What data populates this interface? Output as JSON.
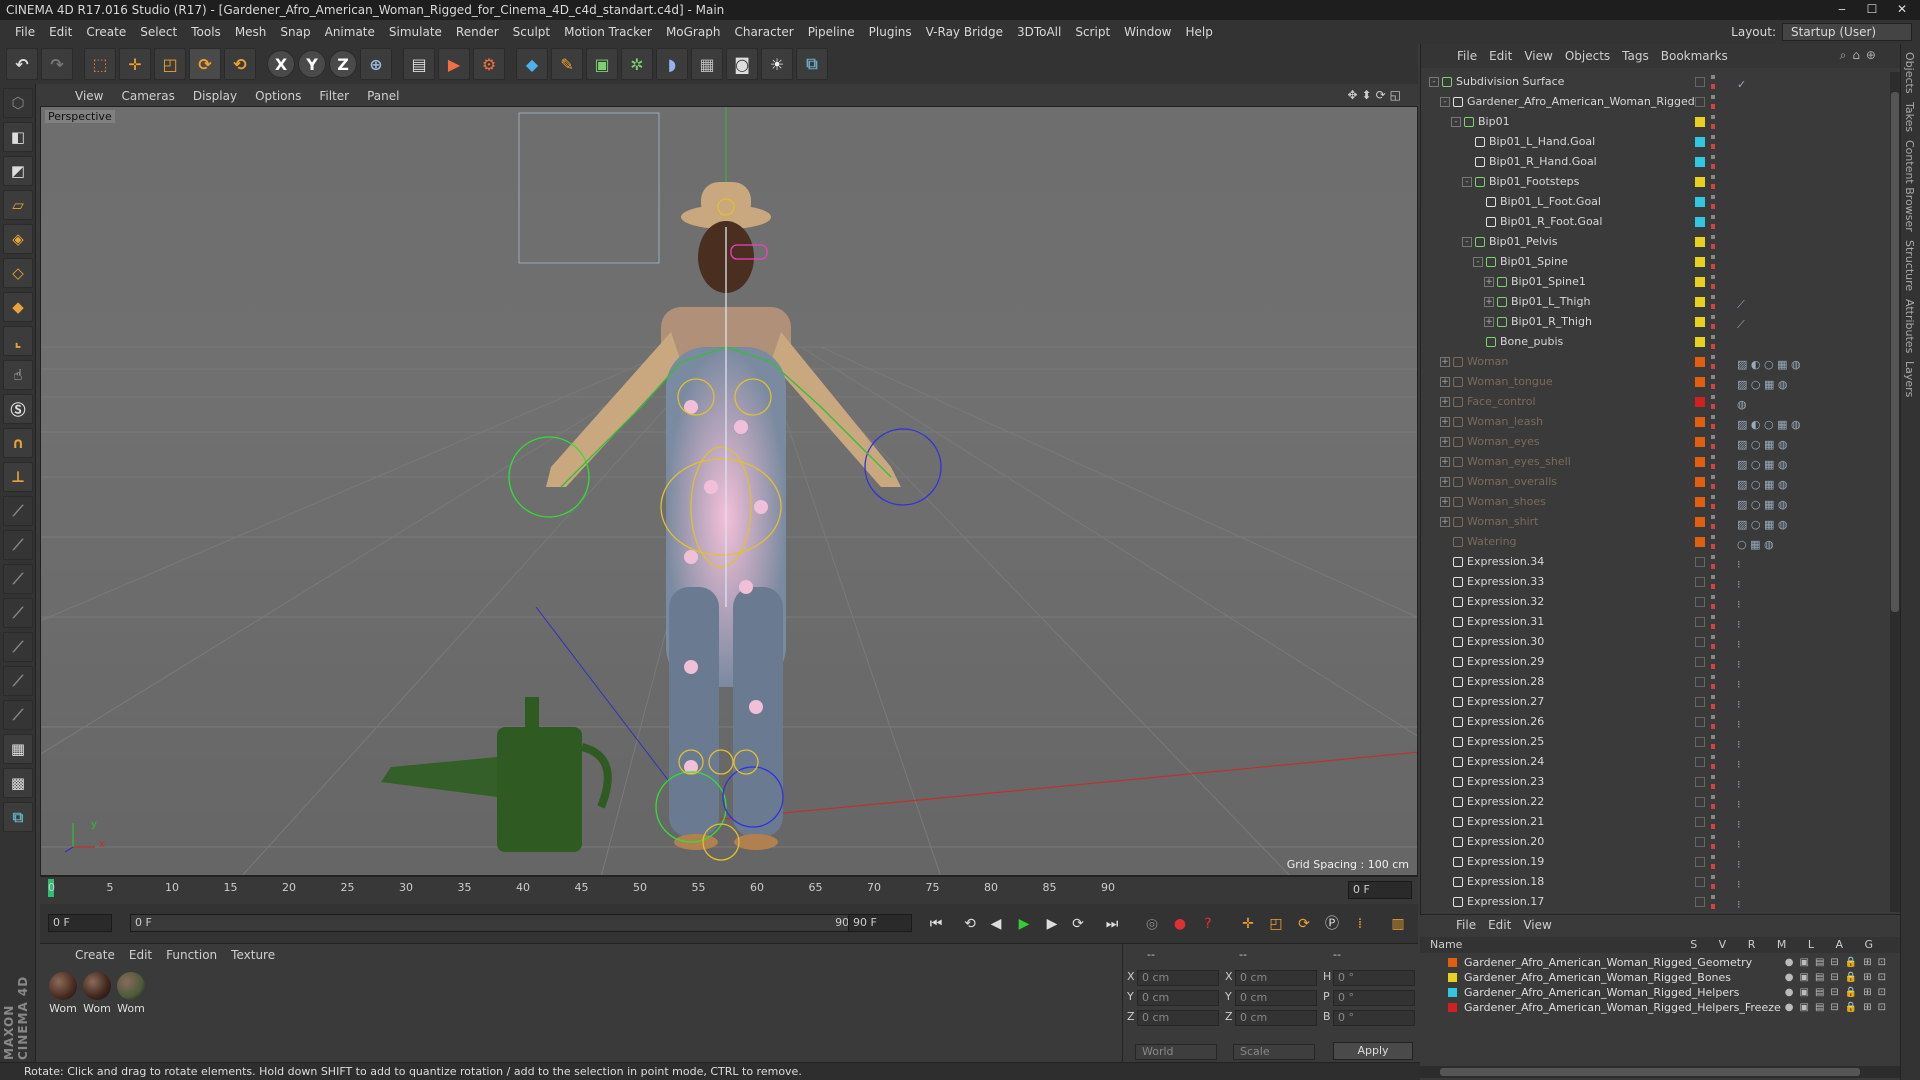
{
  "titlebar": {
    "title": "CINEMA 4D R17.016 Studio (R17) - [Gardener_Afro_American_Woman_Rigged_for_Cinema_4D_c4d_standart.c4d] - Main",
    "minimize": "‒",
    "maximize": "☐",
    "close": "✕"
  },
  "menubar": {
    "items": [
      "File",
      "Edit",
      "Create",
      "Select",
      "Tools",
      "Mesh",
      "Snap",
      "Animate",
      "Simulate",
      "Render",
      "Sculpt",
      "Motion Tracker",
      "MoGraph",
      "Character",
      "Pipeline",
      "Plugins",
      "V-Ray Bridge",
      "3DToAll",
      "Script",
      "Window",
      "Help"
    ],
    "layout_label": "Layout:",
    "layout_value": "Startup (User)"
  },
  "toolbar": {
    "icons": [
      "undo-icon",
      "redo-icon",
      "live-selection-icon",
      "move-icon",
      "scale-icon",
      "rotate-icon",
      "recent-tool-icon",
      "x-axis-icon",
      "y-axis-icon",
      "z-axis-icon",
      "world-coordinate-icon",
      "render-view-icon",
      "render-picture-viewer-icon",
      "edit-render-settings-icon",
      "cube-icon",
      "pen-icon",
      "subdivision-icon",
      "array-icon",
      "deformer-icon",
      "floor-icon",
      "camera-icon",
      "light-icon",
      "python-icon"
    ],
    "axis_x": "X",
    "axis_y": "Y",
    "axis_z": "Z"
  },
  "viewport": {
    "menu": [
      "View",
      "Cameras",
      "Display",
      "Options",
      "Filter",
      "Panel"
    ],
    "label": "Perspective",
    "grid_spacing": "Grid Spacing : 100 cm",
    "axis_x": "x",
    "axis_y": "y"
  },
  "timeline": {
    "ticks": [
      "0",
      "5",
      "10",
      "15",
      "20",
      "25",
      "30",
      "35",
      "40",
      "45",
      "50",
      "55",
      "60",
      "65",
      "70",
      "75",
      "80",
      "85",
      "90"
    ],
    "current_frame": "0 F"
  },
  "transport": {
    "start_field": "0 F",
    "range_start": "0 F",
    "range_end": "90 F",
    "end_field": "90 F"
  },
  "materials": {
    "menu": [
      "Create",
      "Edit",
      "Function",
      "Texture"
    ],
    "items": [
      {
        "label": "Wom",
        "color": "#4a2a20"
      },
      {
        "label": "Wom",
        "color": "#3e241c"
      },
      {
        "label": "Wom",
        "color": "#4a5a3a"
      }
    ]
  },
  "coordinates": {
    "header_left": "--",
    "header_mid": "--",
    "header_right": "--",
    "rows": [
      {
        "axis": "X",
        "pos": "0 cm",
        "axis2": "X",
        "size": "0 cm",
        "rot_label": "H",
        "rot": "0 °"
      },
      {
        "axis": "Y",
        "pos": "0 cm",
        "axis2": "Y",
        "size": "0 cm",
        "rot_label": "P",
        "rot": "0 °"
      },
      {
        "axis": "Z",
        "pos": "0 cm",
        "axis2": "Z",
        "size": "0 cm",
        "rot_label": "B",
        "rot": "0 °"
      }
    ],
    "mode": "World",
    "transform": "Scale",
    "apply": "Apply"
  },
  "statusbar": {
    "text": "Rotate: Click and drag to rotate elements. Hold down SHIFT to add to quantize rotation / add to the selection in point mode, CTRL to remove."
  },
  "objects": {
    "menu": [
      "File",
      "Edit",
      "View",
      "Objects",
      "Tags",
      "Bookmarks"
    ],
    "rows": [
      {
        "name": "Subdivision Surface",
        "indent": 0,
        "color": "#7cd070",
        "swatch": "",
        "dim": false,
        "icon": "subdivision-icon",
        "expand": "-",
        "tag": "✓"
      },
      {
        "name": "Gardener_Afro_American_Woman_Rigged",
        "indent": 1,
        "color": "#e0e0e0",
        "swatch": "",
        "dim": false,
        "icon": "null-icon",
        "expand": "-",
        "tag": ""
      },
      {
        "name": "Bip01",
        "indent": 2,
        "color": "#7cd070",
        "swatch": "#e8d020",
        "dim": false,
        "icon": "bone-icon",
        "expand": "-",
        "tag": ""
      },
      {
        "name": "Bip01_L_Hand.Goal",
        "indent": 3,
        "color": "#e0e0e0",
        "swatch": "#30c8e0",
        "dim": false,
        "icon": "null-icon",
        "expand": "",
        "tag": ""
      },
      {
        "name": "Bip01_R_Hand.Goal",
        "indent": 3,
        "color": "#e0e0e0",
        "swatch": "#30c8e0",
        "dim": false,
        "icon": "null-icon",
        "expand": "",
        "tag": ""
      },
      {
        "name": "Bip01_Footsteps",
        "indent": 3,
        "color": "#7cd070",
        "swatch": "#e8d020",
        "dim": false,
        "icon": "bone-icon",
        "expand": "-",
        "tag": ""
      },
      {
        "name": "Bip01_L_Foot.Goal",
        "indent": 4,
        "color": "#e0e0e0",
        "swatch": "#30c8e0",
        "dim": false,
        "icon": "null-icon",
        "expand": "",
        "tag": ""
      },
      {
        "name": "Bip01_R_Foot.Goal",
        "indent": 4,
        "color": "#e0e0e0",
        "swatch": "#30c8e0",
        "dim": false,
        "icon": "null-icon",
        "expand": "",
        "tag": ""
      },
      {
        "name": "Bip01_Pelvis",
        "indent": 3,
        "color": "#7cd070",
        "swatch": "#e8d020",
        "dim": false,
        "icon": "bone-icon",
        "expand": "-",
        "tag": ""
      },
      {
        "name": "Bip01_Spine",
        "indent": 4,
        "color": "#7cd070",
        "swatch": "#e8d020",
        "dim": false,
        "icon": "bone-icon",
        "expand": "-",
        "tag": ""
      },
      {
        "name": "Bip01_Spine1",
        "indent": 5,
        "color": "#7cd070",
        "swatch": "#e8d020",
        "dim": false,
        "icon": "bone-icon",
        "expand": "+",
        "tag": ""
      },
      {
        "name": "Bip01_L_Thigh",
        "indent": 5,
        "color": "#7cd070",
        "swatch": "#e8d020",
        "dim": false,
        "icon": "bone-icon",
        "expand": "+",
        "tag": "⟋"
      },
      {
        "name": "Bip01_R_Thigh",
        "indent": 5,
        "color": "#7cd070",
        "swatch": "#e8d020",
        "dim": false,
        "icon": "bone-icon",
        "expand": "+",
        "tag": "⟋"
      },
      {
        "name": "Bone_pubis",
        "indent": 4,
        "color": "#7cd070",
        "swatch": "#e8d020",
        "dim": false,
        "icon": "bone-icon",
        "expand": "",
        "tag": ""
      },
      {
        "name": "Woman",
        "indent": 1,
        "color": "#7c6a5a",
        "swatch": "#e06010",
        "dim": true,
        "icon": "figure-icon",
        "expand": "+",
        "tag": "▨ ◐ ○ ▦ ◍"
      },
      {
        "name": "Woman_tongue",
        "indent": 1,
        "color": "#7c6a5a",
        "swatch": "#e06010",
        "dim": true,
        "icon": "figure-icon",
        "expand": "+",
        "tag": "▨ ○ ▦ ◍"
      },
      {
        "name": "Face_control",
        "indent": 1,
        "color": "#7c6a5a",
        "swatch": "#d02020",
        "dim": true,
        "icon": "figure-icon",
        "expand": "+",
        "tag": "◍"
      },
      {
        "name": "Woman_leash",
        "indent": 1,
        "color": "#7c6a5a",
        "swatch": "#e06010",
        "dim": true,
        "icon": "figure-icon",
        "expand": "+",
        "tag": "▨ ◐ ○ ▦ ◍"
      },
      {
        "name": "Woman_eyes",
        "indent": 1,
        "color": "#7c6a5a",
        "swatch": "#e06010",
        "dim": true,
        "icon": "figure-icon",
        "expand": "+",
        "tag": "▨ ○ ▦ ◍"
      },
      {
        "name": "Woman_eyes_shell",
        "indent": 1,
        "color": "#7c6a5a",
        "swatch": "#e06010",
        "dim": true,
        "icon": "figure-icon",
        "expand": "+",
        "tag": "▨ ○ ▦ ◍"
      },
      {
        "name": "Woman_overalls",
        "indent": 1,
        "color": "#7c6a5a",
        "swatch": "#e06010",
        "dim": true,
        "icon": "figure-icon",
        "expand": "+",
        "tag": "▨ ○ ▦ ◍"
      },
      {
        "name": "Woman_shoes",
        "indent": 1,
        "color": "#7c6a5a",
        "swatch": "#e06010",
        "dim": true,
        "icon": "figure-icon",
        "expand": "+",
        "tag": "▨ ○ ▦ ◍"
      },
      {
        "name": "Woman_shirt",
        "indent": 1,
        "color": "#7c6a5a",
        "swatch": "#e06010",
        "dim": true,
        "icon": "figure-icon",
        "expand": "+",
        "tag": "▨ ○ ▦ ◍"
      },
      {
        "name": "Watering",
        "indent": 1,
        "color": "#7c6a5a",
        "swatch": "#e06010",
        "dim": true,
        "icon": "figure-icon",
        "expand": "",
        "tag": "○ ▦ ◍"
      },
      {
        "name": "Expression.34",
        "indent": 1,
        "color": "#e0e0e0",
        "swatch": "",
        "dim": false,
        "icon": "null-icon",
        "expand": "",
        "tag": "⁝"
      },
      {
        "name": "Expression.33",
        "indent": 1,
        "color": "#e0e0e0",
        "swatch": "",
        "dim": false,
        "icon": "null-icon",
        "expand": "",
        "tag": "⁝"
      },
      {
        "name": "Expression.32",
        "indent": 1,
        "color": "#e0e0e0",
        "swatch": "",
        "dim": false,
        "icon": "null-icon",
        "expand": "",
        "tag": "⁝"
      },
      {
        "name": "Expression.31",
        "indent": 1,
        "color": "#e0e0e0",
        "swatch": "",
        "dim": false,
        "icon": "null-icon",
        "expand": "",
        "tag": "⁝"
      },
      {
        "name": "Expression.30",
        "indent": 1,
        "color": "#e0e0e0",
        "swatch": "",
        "dim": false,
        "icon": "null-icon",
        "expand": "",
        "tag": "⁝"
      },
      {
        "name": "Expression.29",
        "indent": 1,
        "color": "#e0e0e0",
        "swatch": "",
        "dim": false,
        "icon": "null-icon",
        "expand": "",
        "tag": "⁝"
      },
      {
        "name": "Expression.28",
        "indent": 1,
        "color": "#e0e0e0",
        "swatch": "",
        "dim": false,
        "icon": "null-icon",
        "expand": "",
        "tag": "⁝"
      },
      {
        "name": "Expression.27",
        "indent": 1,
        "color": "#e0e0e0",
        "swatch": "",
        "dim": false,
        "icon": "null-icon",
        "expand": "",
        "tag": "⁝"
      },
      {
        "name": "Expression.26",
        "indent": 1,
        "color": "#e0e0e0",
        "swatch": "",
        "dim": false,
        "icon": "null-icon",
        "expand": "",
        "tag": "⁝"
      },
      {
        "name": "Expression.25",
        "indent": 1,
        "color": "#e0e0e0",
        "swatch": "",
        "dim": false,
        "icon": "null-icon",
        "expand": "",
        "tag": "⁝"
      },
      {
        "name": "Expression.24",
        "indent": 1,
        "color": "#e0e0e0",
        "swatch": "",
        "dim": false,
        "icon": "null-icon",
        "expand": "",
        "tag": "⁝"
      },
      {
        "name": "Expression.23",
        "indent": 1,
        "color": "#e0e0e0",
        "swatch": "",
        "dim": false,
        "icon": "null-icon",
        "expand": "",
        "tag": "⁝"
      },
      {
        "name": "Expression.22",
        "indent": 1,
        "color": "#e0e0e0",
        "swatch": "",
        "dim": false,
        "icon": "null-icon",
        "expand": "",
        "tag": "⁝"
      },
      {
        "name": "Expression.21",
        "indent": 1,
        "color": "#e0e0e0",
        "swatch": "",
        "dim": false,
        "icon": "null-icon",
        "expand": "",
        "tag": "⁝"
      },
      {
        "name": "Expression.20",
        "indent": 1,
        "color": "#e0e0e0",
        "swatch": "",
        "dim": false,
        "icon": "null-icon",
        "expand": "",
        "tag": "⁝"
      },
      {
        "name": "Expression.19",
        "indent": 1,
        "color": "#e0e0e0",
        "swatch": "",
        "dim": false,
        "icon": "null-icon",
        "expand": "",
        "tag": "⁝"
      },
      {
        "name": "Expression.18",
        "indent": 1,
        "color": "#e0e0e0",
        "swatch": "",
        "dim": false,
        "icon": "null-icon",
        "expand": "",
        "tag": "⁝"
      },
      {
        "name": "Expression.17",
        "indent": 1,
        "color": "#e0e0e0",
        "swatch": "",
        "dim": false,
        "icon": "null-icon",
        "expand": "",
        "tag": "⁝"
      }
    ]
  },
  "layers": {
    "menu": [
      "File",
      "Edit",
      "View"
    ],
    "header_name": "Name",
    "header_cols": "S V R M L A G",
    "rows": [
      {
        "name": "Gardener_Afro_American_Woman_Rigged_Geometry",
        "color": "#e06010"
      },
      {
        "name": "Gardener_Afro_American_Woman_Rigged_Bones",
        "color": "#e8d020"
      },
      {
        "name": "Gardener_Afro_American_Woman_Rigged_Helpers",
        "color": "#30c8e0"
      },
      {
        "name": "Gardener_Afro_American_Woman_Rigged_Helpers_Freeze",
        "color": "#d02020"
      }
    ]
  },
  "sidetabs": [
    "Objects",
    "Takes",
    "Content Browser",
    "Structure",
    "Attributes",
    "Layers"
  ]
}
